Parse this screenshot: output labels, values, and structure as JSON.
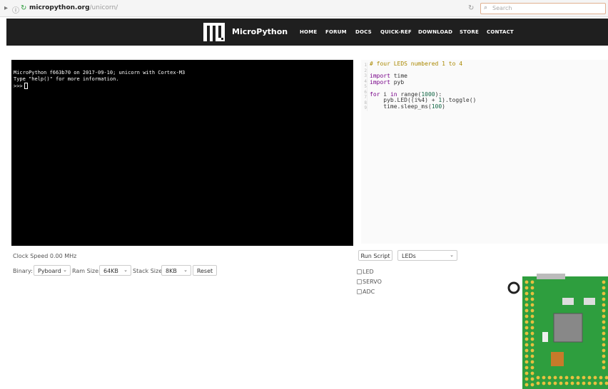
{
  "browser": {
    "url_domain": "micropython.org",
    "url_path": "/unicorn/",
    "search_placeholder": "Search",
    "icons": [
      "sidebar-icon",
      "info-icon",
      "reload-icon",
      "search-icon"
    ]
  },
  "nav": {
    "brand": "MicroPython",
    "links": [
      "HOME",
      "FORUM",
      "DOCS",
      "QUICK-REF",
      "DOWNLOAD",
      "STORE",
      "CONTACT"
    ]
  },
  "terminal": {
    "line1": "MicroPython f663b70 on 2017-09-10; unicorn with Cortex-M3",
    "line2": "Type \"help()\" for more information.",
    "prompt": ">>>"
  },
  "editor": {
    "line_numbers": [
      "1",
      "2",
      "3",
      "4",
      "5",
      "6",
      "7",
      "8",
      "9"
    ],
    "comment": "# four LEDS numbered 1 to 4",
    "import_kw": "import",
    "mod1": "time",
    "mod2": "pyb",
    "for_kw": "for",
    "loop_var": "i",
    "in_kw": "in",
    "range_call": "range(",
    "range_arg": "1000",
    "range_close": "):",
    "led_stmt_a": "pyb.LED((i%4) + ",
    "led_num": "1",
    "led_stmt_b": ").toggle()",
    "sleep_a": "time.sleep_ms(",
    "sleep_num": "100",
    "sleep_b": ")"
  },
  "controls": {
    "clock": "Clock Speed 0.00 MHz",
    "binary_label": "Binary:",
    "binary_value": "Pyboard",
    "ram_label": "Ram Size:",
    "ram_value": "64KB",
    "stack_label": "Stack Size:",
    "stack_value": "8KB",
    "reset": "Reset",
    "run_script": "Run Script",
    "demo_value": "LEDs",
    "checkboxes": [
      "LED",
      "SERVO",
      "ADC"
    ]
  },
  "colors": {
    "nav_bg": "#1f1f1f",
    "terminal_bg": "#000000",
    "board_green": "#2e9e3e",
    "pad_gold": "#e8c040"
  }
}
